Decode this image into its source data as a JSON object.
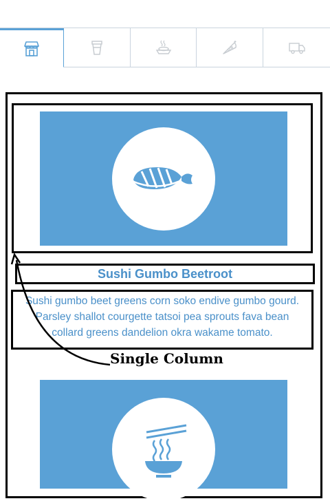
{
  "tabs": [
    {
      "icon": "storefront-icon",
      "active": true
    },
    {
      "icon": "cup-icon",
      "active": false
    },
    {
      "icon": "hot-dish-icon",
      "active": false
    },
    {
      "icon": "pizza-slice-icon",
      "active": false
    },
    {
      "icon": "delivery-truck-icon",
      "active": false
    }
  ],
  "colors": {
    "accent": "#5aa1d6",
    "text": "#4a90c9",
    "outline": "#000000"
  },
  "card": {
    "image_icon": "sushi-icon",
    "title": "Sushi Gumbo Beetroot",
    "description_lines": [
      "Sushi gumbo beet greens corn soko endive gumbo gourd.",
      "Parsley shallot courgette tatsoi pea sprouts fava bean",
      "collard greens dandelion okra wakame tomato."
    ]
  },
  "annotation": {
    "label": "Single Column"
  },
  "second_card": {
    "image_icon": "noodle-bowl-icon"
  }
}
